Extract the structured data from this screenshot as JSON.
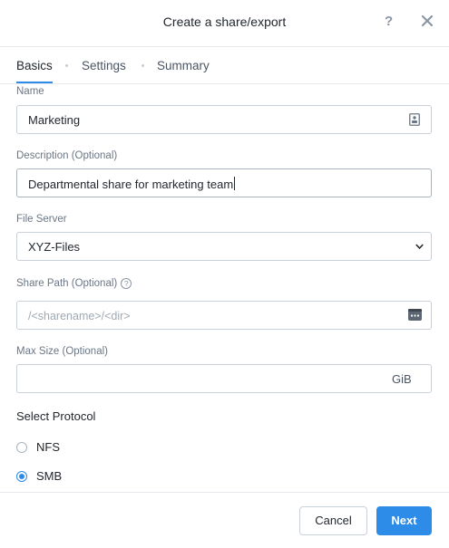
{
  "dialog": {
    "title": "Create a share/export",
    "help_label": "?",
    "close_icon": "close-icon"
  },
  "tabs": [
    {
      "label": "Basics",
      "active": true
    },
    {
      "label": "Settings",
      "active": false
    },
    {
      "label": "Summary",
      "active": false
    }
  ],
  "form": {
    "name": {
      "label": "Name",
      "value": "Marketing",
      "icon": "contact-card-icon"
    },
    "description": {
      "label": "Description (Optional)",
      "value": "Departmental share for marketing team"
    },
    "file_server": {
      "label": "File Server",
      "value": "XYZ-Files",
      "icon": "chevron-down-icon"
    },
    "share_path": {
      "label": "Share Path (Optional)",
      "help": "?",
      "placeholder": "/<sharename>/<dir>",
      "icon": "ellipsis-icon"
    },
    "max_size": {
      "label": "Max Size (Optional)",
      "value": "",
      "unit": "GiB"
    }
  },
  "protocol": {
    "title": "Select Protocol",
    "options": [
      {
        "label": "NFS",
        "checked": false
      },
      {
        "label": "SMB",
        "checked": true
      }
    ]
  },
  "footer": {
    "cancel_label": "Cancel",
    "next_label": "Next"
  },
  "colors": {
    "accent": "#2d8ce8",
    "border": "#c9d0d7",
    "muted_text": "#6b7785"
  }
}
